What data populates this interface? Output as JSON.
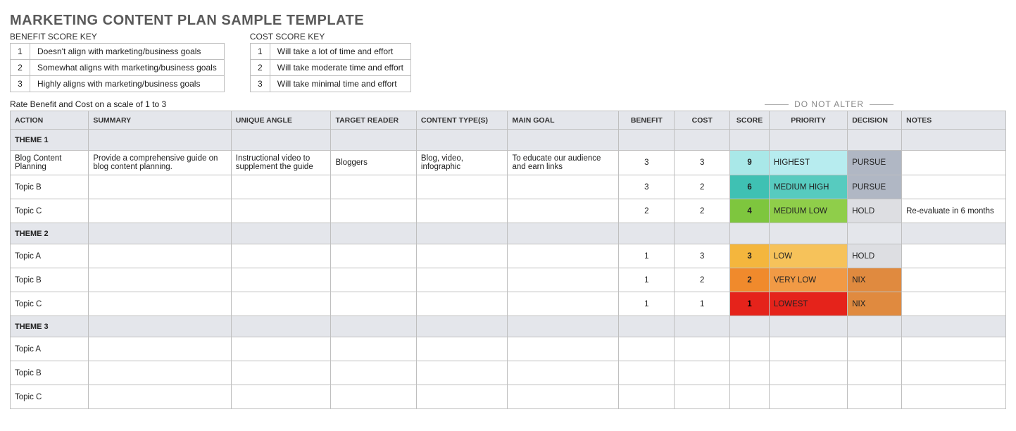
{
  "title": "MARKETING CONTENT PLAN SAMPLE TEMPLATE",
  "benefitKey": {
    "title": "BENEFIT SCORE KEY",
    "rows": [
      {
        "n": "1",
        "t": "Doesn't align with marketing/business goals"
      },
      {
        "n": "2",
        "t": "Somewhat aligns with marketing/business goals"
      },
      {
        "n": "3",
        "t": "Highly aligns with marketing/business goals"
      }
    ]
  },
  "costKey": {
    "title": "COST SCORE KEY",
    "rows": [
      {
        "n": "1",
        "t": "Will take a lot of time and effort"
      },
      {
        "n": "2",
        "t": "Will take moderate time and effort"
      },
      {
        "n": "3",
        "t": "Will take minimal time and effort"
      }
    ]
  },
  "rateLine": "Rate Benefit and Cost on a scale of 1 to 3",
  "doNotAlter": "DO NOT ALTER",
  "headers": {
    "action": "ACTION",
    "summary": "SUMMARY",
    "angle": "UNIQUE ANGLE",
    "reader": "TARGET READER",
    "type": "CONTENT TYPE(S)",
    "goal": "MAIN GOAL",
    "benefit": "BENEFIT",
    "cost": "COST",
    "score": "SCORE",
    "priority": "PRIORITY",
    "decision": "DECISION",
    "notes": "NOTES"
  },
  "sections": [
    {
      "theme": "THEME 1",
      "rows": [
        {
          "action": "Blog Content Planning",
          "summary": "Provide a comprehensive guide on blog content planning.",
          "angle": "Instructional video to supplement the guide",
          "reader": "Bloggers",
          "type": "Blog, video, infographic",
          "goal": "To educate our audience and earn links",
          "benefit": "3",
          "cost": "3",
          "score": "9",
          "priority": "HIGHEST",
          "decision": "PURSUE",
          "notes": "",
          "scoreCls": "sc-9",
          "prioCls": "pr-highest",
          "decCls": "dec-pursue"
        },
        {
          "action": "Topic B",
          "summary": "",
          "angle": "",
          "reader": "",
          "type": "",
          "goal": "",
          "benefit": "3",
          "cost": "2",
          "score": "6",
          "priority": "MEDIUM HIGH",
          "decision": "PURSUE",
          "notes": "",
          "scoreCls": "sc-6",
          "prioCls": "pr-mediumhigh",
          "decCls": "dec-pursue"
        },
        {
          "action": "Topic C",
          "summary": "",
          "angle": "",
          "reader": "",
          "type": "",
          "goal": "",
          "benefit": "2",
          "cost": "2",
          "score": "4",
          "priority": "MEDIUM LOW",
          "decision": "HOLD",
          "notes": "Re-evaluate in 6 months",
          "scoreCls": "sc-4",
          "prioCls": "pr-mediumlow",
          "decCls": "dec-hold"
        }
      ]
    },
    {
      "theme": "THEME 2",
      "rows": [
        {
          "action": "Topic A",
          "summary": "",
          "angle": "",
          "reader": "",
          "type": "",
          "goal": "",
          "benefit": "1",
          "cost": "3",
          "score": "3",
          "priority": "LOW",
          "decision": "HOLD",
          "notes": "",
          "scoreCls": "sc-3",
          "prioCls": "pr-low",
          "decCls": "dec-hold"
        },
        {
          "action": "Topic B",
          "summary": "",
          "angle": "",
          "reader": "",
          "type": "",
          "goal": "",
          "benefit": "1",
          "cost": "2",
          "score": "2",
          "priority": "VERY LOW",
          "decision": "NIX",
          "notes": "",
          "scoreCls": "sc-2",
          "prioCls": "pr-verylow",
          "decCls": "dec-nix"
        },
        {
          "action": "Topic C",
          "summary": "",
          "angle": "",
          "reader": "",
          "type": "",
          "goal": "",
          "benefit": "1",
          "cost": "1",
          "score": "1",
          "priority": "LOWEST",
          "decision": "NIX",
          "notes": "",
          "scoreCls": "sc-1",
          "prioCls": "pr-lowest",
          "decCls": "dec-nix"
        }
      ]
    },
    {
      "theme": "THEME 3",
      "rows": [
        {
          "action": "Topic A",
          "summary": "",
          "angle": "",
          "reader": "",
          "type": "",
          "goal": "",
          "benefit": "",
          "cost": "",
          "score": "",
          "priority": "",
          "decision": "",
          "notes": "",
          "scoreCls": "",
          "prioCls": "",
          "decCls": ""
        },
        {
          "action": "Topic B",
          "summary": "",
          "angle": "",
          "reader": "",
          "type": "",
          "goal": "",
          "benefit": "",
          "cost": "",
          "score": "",
          "priority": "",
          "decision": "",
          "notes": "",
          "scoreCls": "",
          "prioCls": "",
          "decCls": ""
        },
        {
          "action": "Topic C",
          "summary": "",
          "angle": "",
          "reader": "",
          "type": "",
          "goal": "",
          "benefit": "",
          "cost": "",
          "score": "",
          "priority": "",
          "decision": "",
          "notes": "",
          "scoreCls": "",
          "prioCls": "",
          "decCls": ""
        }
      ]
    }
  ]
}
